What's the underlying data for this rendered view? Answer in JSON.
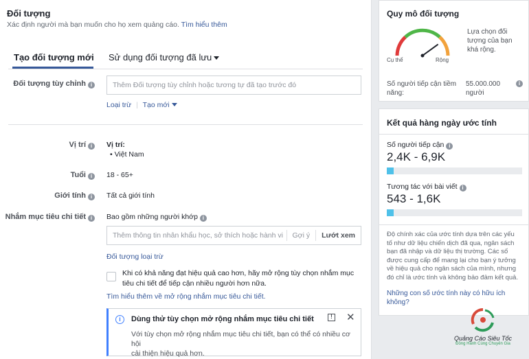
{
  "header": {
    "title": "Đối tượng",
    "description": "Xác định người mà bạn muốn cho họ xem quảng cáo.",
    "learn_more": "Tìm hiểu thêm"
  },
  "tabs": [
    {
      "label": "Tạo đối tượng mới"
    },
    {
      "label": "Sử dụng đối tượng đã lưu"
    }
  ],
  "custom_audience": {
    "label": "Đối tượng tùy chỉnh",
    "placeholder": "Thêm Đối tượng tùy chỉnh hoặc tương tự đã tạo trước đó",
    "exclude_link": "Loại trừ",
    "create_new_link": "Tạo mới"
  },
  "location": {
    "label": "Vị trí",
    "heading": "Vị trí:",
    "value": "Việt Nam"
  },
  "age": {
    "label": "Tuổi",
    "value": "18 - 65+"
  },
  "gender": {
    "label": "Giới tính",
    "value": "Tất cả giới tính"
  },
  "detailed_targeting": {
    "label": "Nhắm mục tiêu chi tiết",
    "include_text": "Bao gồm những người khớp",
    "placeholder": "Thêm thông tin nhân khẩu học, sở thích hoặc hành vi",
    "suggest": "Gợi ý",
    "browse": "Lướt xem",
    "exclude_link": "Đối tượng loại trừ",
    "expand_line1": "Khi có khả năng đạt hiệu quả cao hơn, hãy mở rộng tùy chọn nhắm mục",
    "expand_line2": "tiêu chi tiết để tiếp cận nhiều người hơn nữa.",
    "learn_more_link": "Tìm hiểu thêm về mở rộng nhắm mục tiêu chi tiết."
  },
  "tip": {
    "title": "Dùng thử tùy chọn mở rộng nhắm mục tiêu chi tiết",
    "line1": "Với tùy chọn mở rộng nhắm mục tiêu chi tiết, bạn có thể có nhiều cơ hội",
    "line2": "cải thiện hiệu quả hơn."
  },
  "audience_size": {
    "title": "Quy mô đối tượng",
    "specific": "Cụ thể",
    "broad": "Rộng",
    "desc_line1": "Lựa chọn đối",
    "desc_line2": "tượng của bạn",
    "desc_line3": "khá rộng.",
    "reach_label_line1": "Số người tiếp cận tiềm",
    "reach_label_line2": "năng:",
    "reach_value_line1": "55.000.000",
    "reach_value_line2": "người",
    "gauge_fraction": 0.8
  },
  "daily_results": {
    "title": "Kết quả hàng ngày ước tính",
    "reach_label": "Số người tiếp cận",
    "reach_value": "2,4K - 6,9K",
    "reach_fraction": 0.05,
    "engagement_label": "Tương tác với bài viết",
    "engagement_value": "543 - 1,6K",
    "engagement_fraction": 0.05,
    "note_lines": [
      "Độ chính xác của ước tính dựa trên các yếu",
      "tố như dữ liệu chiến dịch đã qua, ngân sách",
      "bạn đã nhập và dữ liệu thị trường. Các số",
      "được cung cấp để mang lại cho bạn ý tưởng",
      "về hiệu quả cho ngân sách của mình, nhưng",
      "đó chỉ là ước tính và không bảo đảm kết quả."
    ],
    "helpful_line1": "Những con số ước tính này có hữu ích",
    "helpful_line2": "không?"
  },
  "watermark": {
    "brand": "Quảng Cáo Siêu Tốc",
    "tagline": "Đồng Hành Cùng Chuyên Gia"
  },
  "colors": {
    "accent": "#365899",
    "tip_border": "#4080ff",
    "bar_fill": "#4fc1e9"
  }
}
